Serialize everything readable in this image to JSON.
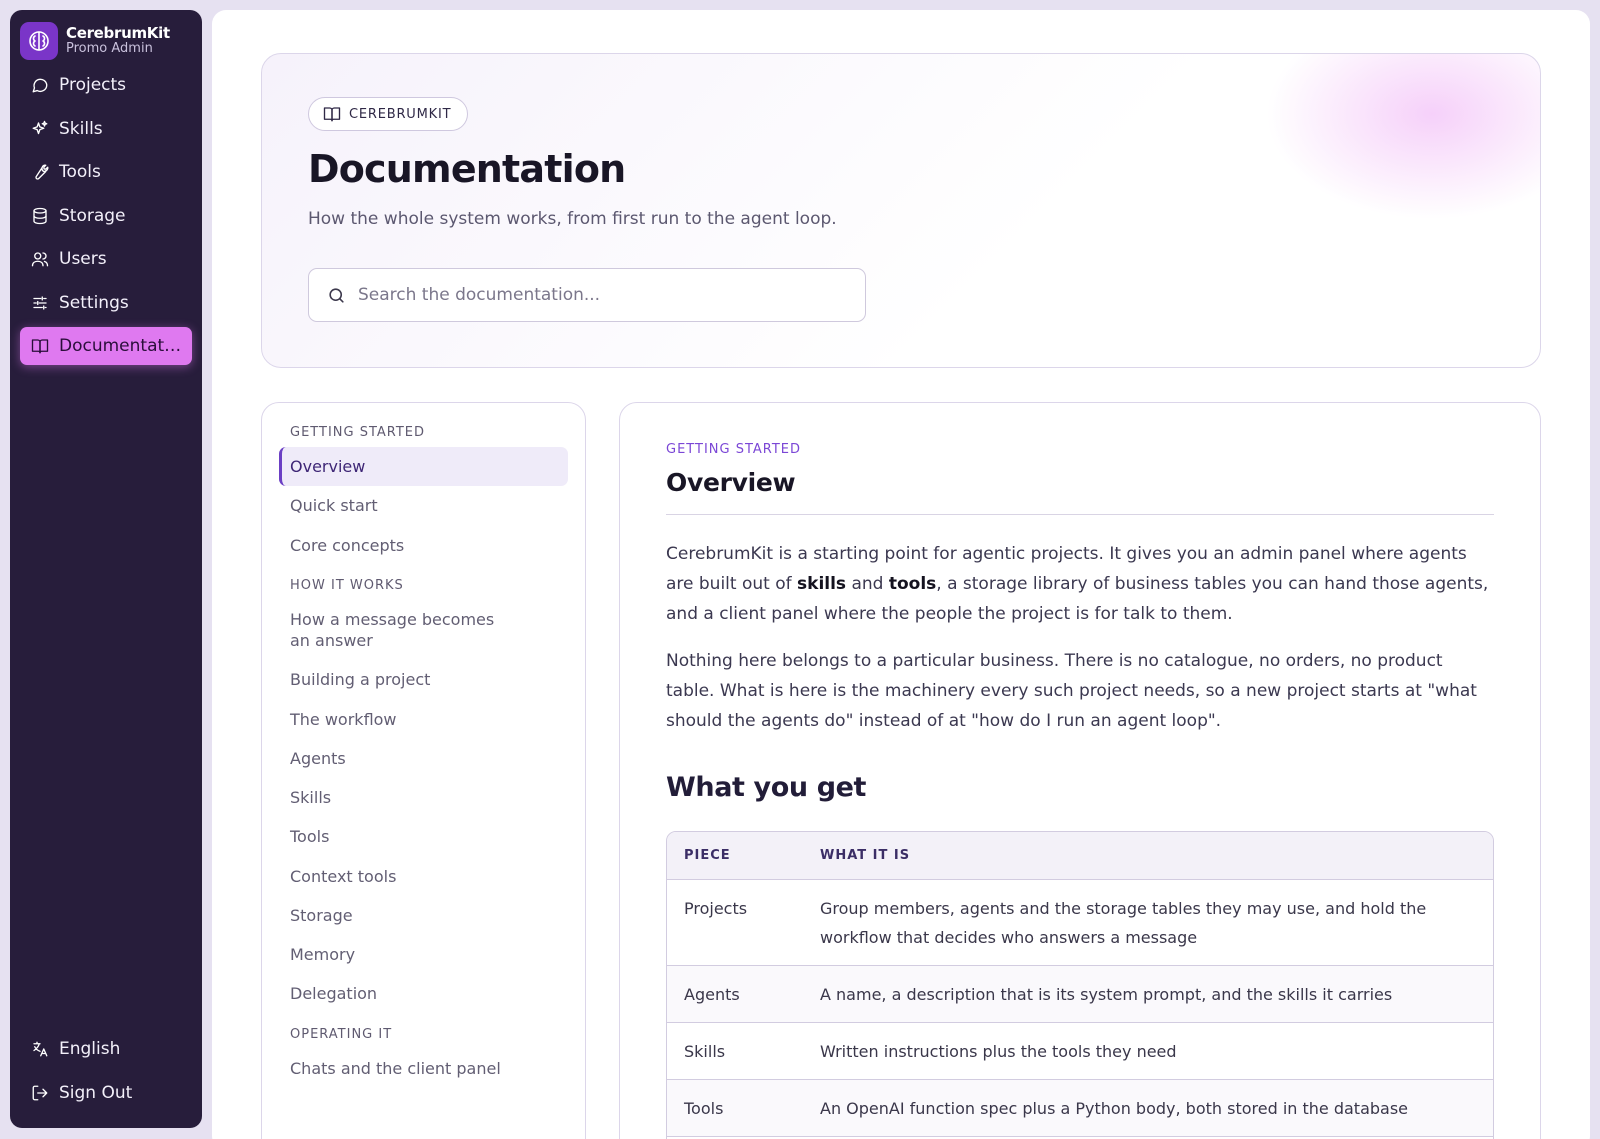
{
  "brand": {
    "name": "CerebrumKit",
    "subtitle": "Promo Admin"
  },
  "nav": {
    "items": [
      {
        "label": "Projects",
        "icon": "chat-bubble-icon"
      },
      {
        "label": "Skills",
        "icon": "sparkles-icon"
      },
      {
        "label": "Tools",
        "icon": "wrench-icon"
      },
      {
        "label": "Storage",
        "icon": "database-icon"
      },
      {
        "label": "Users",
        "icon": "users-icon"
      },
      {
        "label": "Settings",
        "icon": "sliders-icon"
      },
      {
        "label": "Documentation",
        "icon": "book-icon",
        "active": true
      }
    ],
    "bottom": [
      {
        "label": "English",
        "icon": "translate-icon"
      },
      {
        "label": "Sign Out",
        "icon": "sign-out-icon"
      }
    ]
  },
  "hero": {
    "badge": "CEREBRUMKIT",
    "title": "Documentation",
    "subtitle": "How the whole system works, from first run to the agent loop.",
    "search_placeholder": "Search the documentation..."
  },
  "toc": {
    "sections": [
      {
        "title": "GETTING STARTED",
        "items": [
          "Overview",
          "Quick start",
          "Core concepts"
        ]
      },
      {
        "title": "HOW IT WORKS",
        "items": [
          "How a message becomes an answer",
          "Building a project",
          "The workflow",
          "Agents",
          "Skills",
          "Tools",
          "Context tools",
          "Storage",
          "Memory",
          "Delegation"
        ]
      },
      {
        "title": "OPERATING IT",
        "items": [
          "Chats and the client panel"
        ]
      }
    ],
    "active": "Overview"
  },
  "article": {
    "eyebrow": "GETTING STARTED",
    "title": "Overview",
    "p1_a": "CerebrumKit is a starting point for agentic projects. It gives you an admin panel where agents are built out of ",
    "p1_b": "skills",
    "p1_c": " and ",
    "p1_d": "tools",
    "p1_e": ", a storage library of business tables you can hand those agents, and a client panel where the people the project is for talk to them.",
    "p2": "Nothing here belongs to a particular business. There is no catalogue, no orders, no product table. What is here is the machinery every such project needs, so a new project starts at \"what should the agents do\" instead of at \"how do I run an agent loop\".",
    "h3": "What you get",
    "table": {
      "headers": [
        "PIECE",
        "WHAT IT IS"
      ],
      "rows": [
        [
          "Projects",
          "Group members, agents and the storage tables they may use, and hold the workflow that decides who answers a message"
        ],
        [
          "Agents",
          "A name, a description that is its system prompt, and the skills it carries"
        ],
        [
          "Skills",
          "Written instructions plus the tools they need"
        ],
        [
          "Tools",
          "An OpenAI function spec plus a Python body, both stored in the database"
        ]
      ]
    }
  },
  "colors": {
    "sidebar_bg": "#271d3b",
    "active_nav": "#df79f0",
    "accent": "#7b47d6",
    "page_bg": "#e6e1f1"
  }
}
